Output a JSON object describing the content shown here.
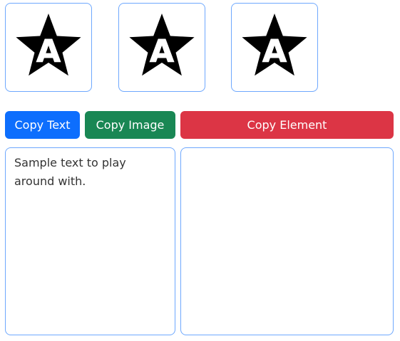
{
  "star_cards": [
    {
      "icon": "star-letter-a-icon",
      "letter": "A"
    },
    {
      "icon": "star-letter-a-icon",
      "letter": "A"
    },
    {
      "icon": "star-letter-a-icon",
      "letter": "A"
    }
  ],
  "buttons": {
    "copy_text": "Copy Text",
    "copy_image": "Copy Image",
    "copy_element": "Copy Element"
  },
  "text_area": {
    "value": "Sample text to play around with."
  },
  "paste_area": {
    "content": ""
  },
  "colors": {
    "primary": "#0d6efd",
    "success": "#198754",
    "danger": "#dc3545",
    "border": "#6ea8fe"
  }
}
